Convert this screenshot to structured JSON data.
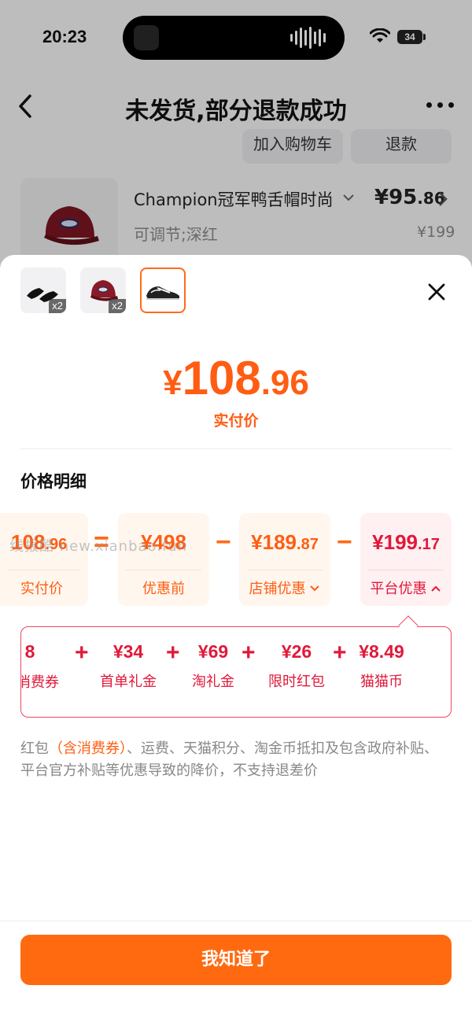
{
  "status_bar": {
    "time": "20:23",
    "battery": "34"
  },
  "nav": {
    "title": "未发货,部分退款成功"
  },
  "bg_actions": {
    "add_to_cart": "加入购物车",
    "refund": "退款"
  },
  "bg_product": {
    "name": "Champion冠军鸭舌帽时尚",
    "spec": "可调节;深红",
    "price_int": "¥95",
    "price_dec": ".86",
    "original_price": "¥199"
  },
  "sheet": {
    "thumbs": [
      {
        "name": "socks",
        "qty": "x2"
      },
      {
        "name": "cap",
        "qty": "x2"
      },
      {
        "name": "shoes",
        "qty": ""
      }
    ],
    "price": {
      "yen": "¥",
      "int": "108",
      "dec": ".96",
      "label": "实付价"
    },
    "section_title": "价格明细",
    "formula": {
      "paid": {
        "value_big": "108",
        "value_small": ".96",
        "label": "实付价"
      },
      "eq": "=",
      "before": {
        "value_big": "¥498",
        "label": "优惠前"
      },
      "minus1": "−",
      "store": {
        "value_big": "¥189",
        "value_small": ".87",
        "label": "店铺优惠"
      },
      "minus2": "−",
      "platform": {
        "value_big": "¥199",
        "value_small": ".17",
        "label": "平台优惠"
      }
    },
    "watermark": "线报酷 new.xianbao.fun",
    "platform_details": [
      {
        "value": "8",
        "label": "消费券"
      },
      {
        "value": "¥34",
        "label": "首单礼金"
      },
      {
        "value": "¥69",
        "label": "淘礼金"
      },
      {
        "value": "¥26",
        "label": "限时红包"
      },
      {
        "value": "¥8.49",
        "label": "猫猫币"
      }
    ],
    "plus": "+",
    "note_prefix": "红包",
    "note_highlight": "（含消费券）",
    "note_rest": "、运费、天猫积分、淘金币抵扣及包含政府补贴、平台官方补贴等优惠导致的降价，不支持退差价",
    "confirm_button": "我知道了"
  },
  "colors": {
    "accent": "#ff6a10",
    "price": "#ff5d13",
    "platform_red": "#e0193a"
  }
}
